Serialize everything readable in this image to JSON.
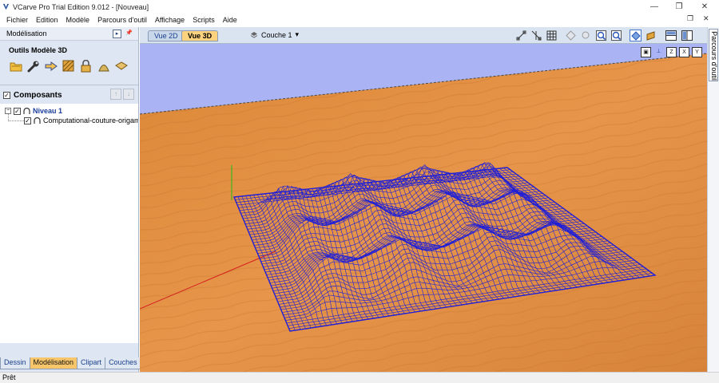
{
  "window": {
    "title": "VCarve Pro Trial Edition 9.012 - [Nouveau]"
  },
  "menu": [
    "Fichier",
    "Edition",
    "Modèle",
    "Parcours d'outil",
    "Affichage",
    "Scripts",
    "Aide"
  ],
  "left_panel": {
    "header": "Modélisation",
    "tools_title": "Outils Modèle 3D",
    "tool_icons": [
      "open-model-icon",
      "wrench-icon",
      "arrow-move-icon",
      "texture-icon",
      "lock-icon",
      "distort-icon",
      "slice-icon"
    ],
    "components_title": "Composants",
    "tree": [
      {
        "label": "Niveau 1",
        "checked": true,
        "level": 0
      },
      {
        "label": "Computational-couture-origami",
        "checked": true,
        "level": 1
      }
    ]
  },
  "bottom_tabs": [
    "Dessin",
    "Modélisation",
    "Clipart",
    "Couches"
  ],
  "active_bottom_tab": "Modélisation",
  "view_tabs": {
    "tab_2d": "Vue 2D",
    "tab_3d": "Vue 3D"
  },
  "layer": {
    "label": "Couche 1"
  },
  "side_tab": "Parcours d'outil",
  "status": "Prêt",
  "axis_buttons": [
    "Z",
    "X",
    "Y"
  ],
  "colors": {
    "sky": "#aab4f4",
    "wood": "#e18a3a",
    "wireframe": "#1f1fd8",
    "active_tab": "#fbd37e",
    "panel": "#dde6f2"
  }
}
